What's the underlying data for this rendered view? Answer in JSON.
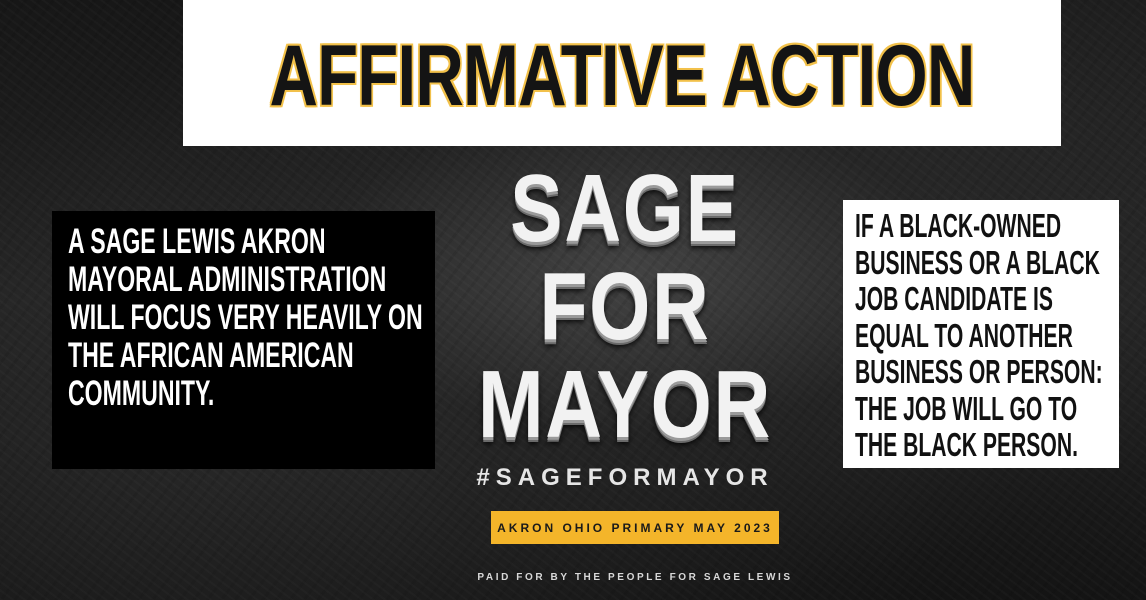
{
  "headline": "AFFIRMATIVE ACTION",
  "left_panel": {
    "text": "A SAGE LEWIS AKRON MAYORAL ADMINISTRATION WILL FOCUS VERY HEAVILY ON THE AFRICAN AMERICAN COMMUNITY."
  },
  "center": {
    "line1": "SAGE",
    "line2": "FOR",
    "line3": "MAYOR",
    "hashtag": "#SAGEFORMAYOR",
    "primary": "AKRON OHIO PRIMARY MAY 2023",
    "paid_for": "PAID FOR BY THE PEOPLE FOR SAGE LEWIS"
  },
  "right_panel": {
    "text": "IF A BLACK-OWNED BUSINESS OR A BLACK JOB CANDIDATE IS EQUAL TO ANOTHER BUSINESS OR PERSON: THE JOB WILL GO TO THE BLACK PERSON."
  },
  "colors": {
    "accent": "#f4b52a",
    "background": "#1b1b1b",
    "headline_outline": "#f2c14a"
  }
}
